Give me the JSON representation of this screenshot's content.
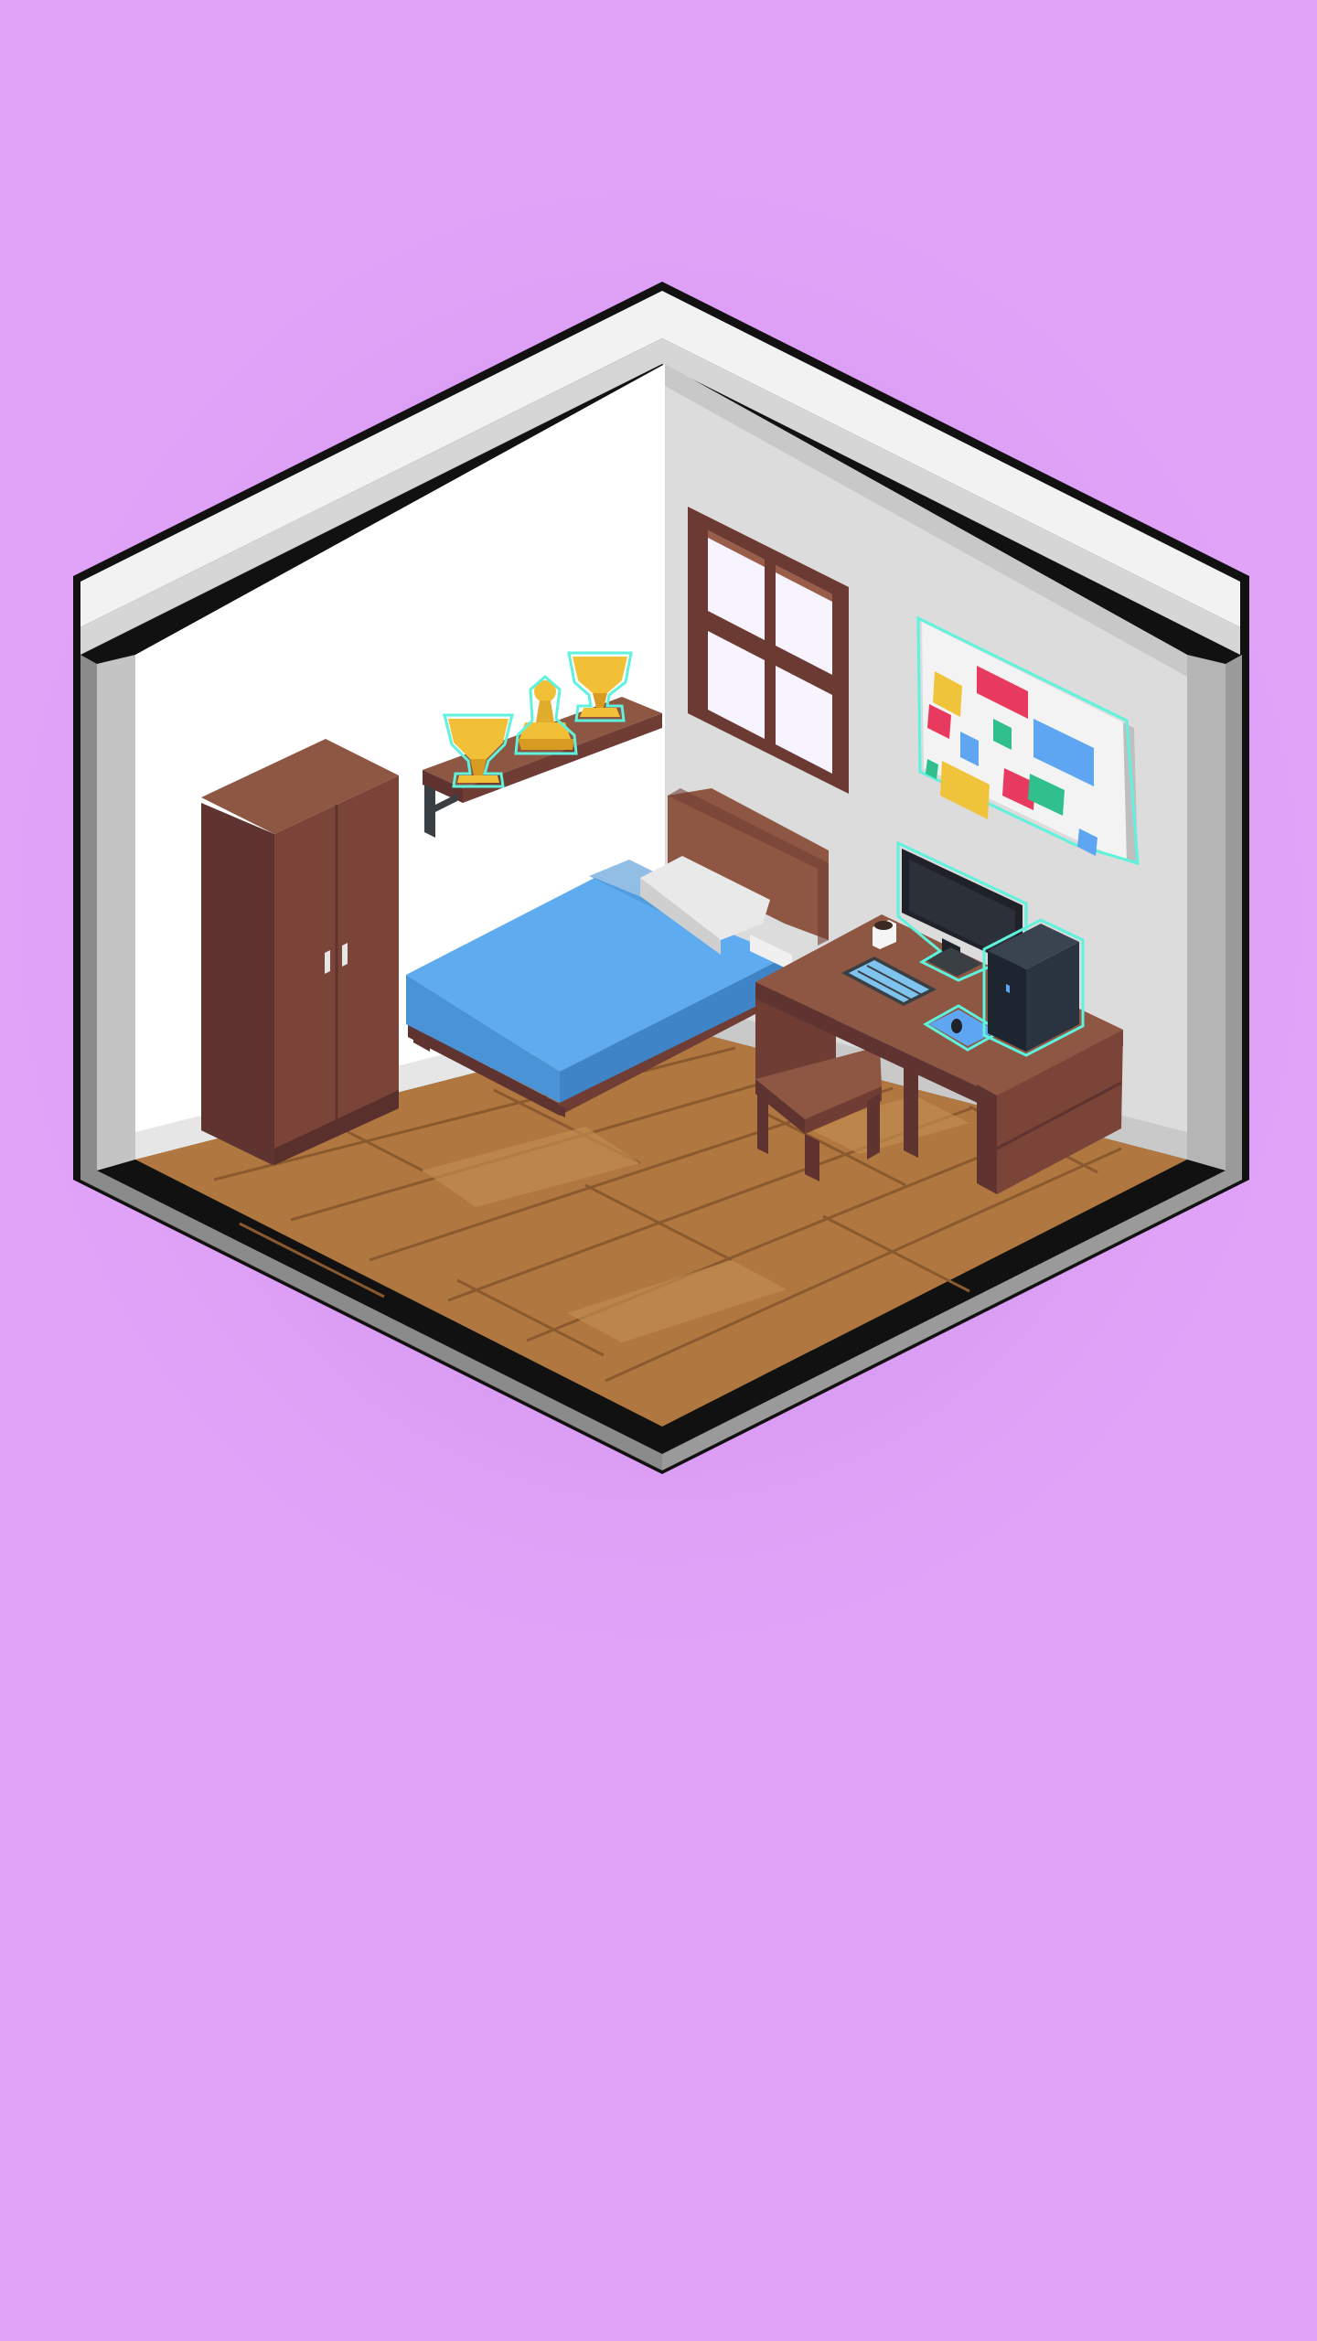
{
  "scene": {
    "type": "isometric-room",
    "highlighted_items": [
      "trophy-shelf",
      "computer-setup",
      "sticky-note-board"
    ],
    "colors": {
      "background": "#e0a3f8",
      "shadow": "#cf8fe8",
      "wall_top": "#eeeeee",
      "left_wall": "#ffffff",
      "right_wall": "#dcdcdc",
      "floor": "#b07840",
      "wood_dark": "#5e3330",
      "wood_mid": "#7a4438",
      "wood_light": "#8d5743",
      "blanket": "#5eacef",
      "trophy_gold": "#f2c037",
      "highlight": "#5ff2dc"
    }
  }
}
